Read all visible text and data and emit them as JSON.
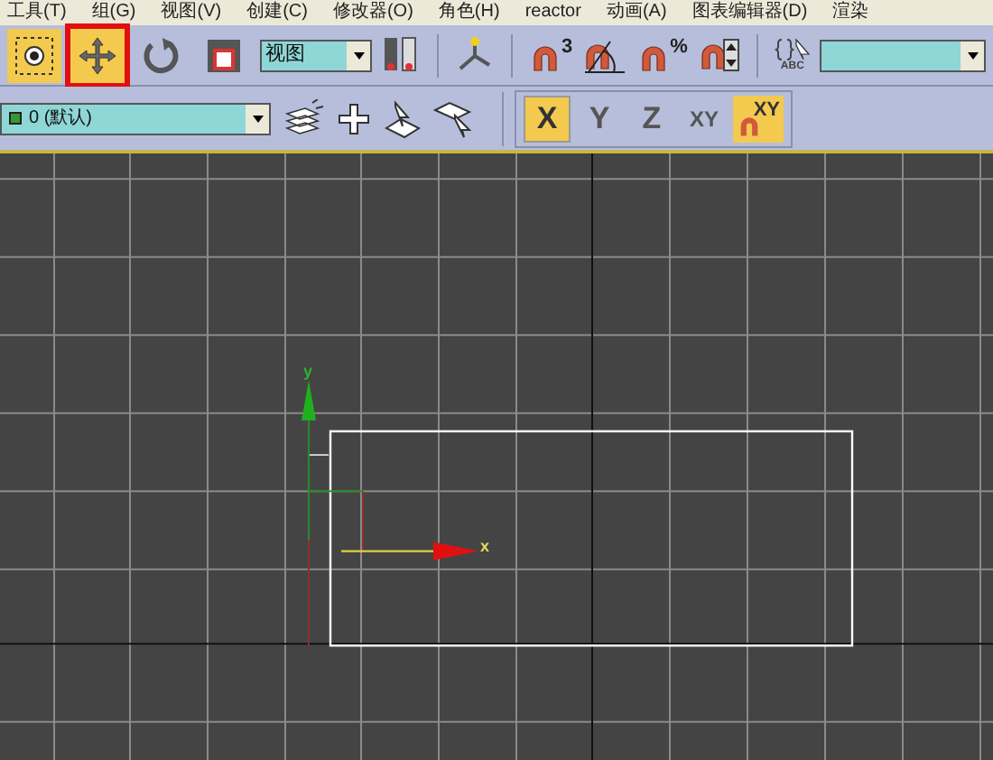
{
  "menu_bar": [
    "工具(T)",
    "组(G)",
    "视图(V)",
    "创建(C)",
    "修改器(O)",
    "角色(H)",
    "reactor",
    "动画(A)",
    "图表编辑器(D)",
    "渲染"
  ],
  "main_toolbar": {
    "tools": [
      {
        "kind": "select-manipulate",
        "selected": true,
        "highlighted": false
      },
      {
        "kind": "move",
        "selected": true,
        "highlighted": true
      },
      {
        "kind": "rotate",
        "selected": false,
        "highlighted": false
      },
      {
        "kind": "scale",
        "selected": false,
        "highlighted": false
      }
    ],
    "reference_coordinate": "视图",
    "snaps": [
      {
        "kind": "snap3d",
        "label": "3"
      },
      {
        "kind": "angle"
      },
      {
        "kind": "percent",
        "label": "%"
      },
      {
        "kind": "spinner"
      }
    ],
    "named_selection": {
      "label": "ABC"
    }
  },
  "layer_toolbar": {
    "layer": "0 (默认)"
  },
  "axis_constraints": [
    {
      "label": "X",
      "selected": true
    },
    {
      "label": "Y",
      "selected": false
    },
    {
      "label": "Z",
      "selected": false
    },
    {
      "label": "XY",
      "selected": false
    }
  ],
  "axis_snap": {
    "label": "XY",
    "selected": true
  },
  "viewport": {
    "x_label": "x",
    "y_label": "y"
  }
}
